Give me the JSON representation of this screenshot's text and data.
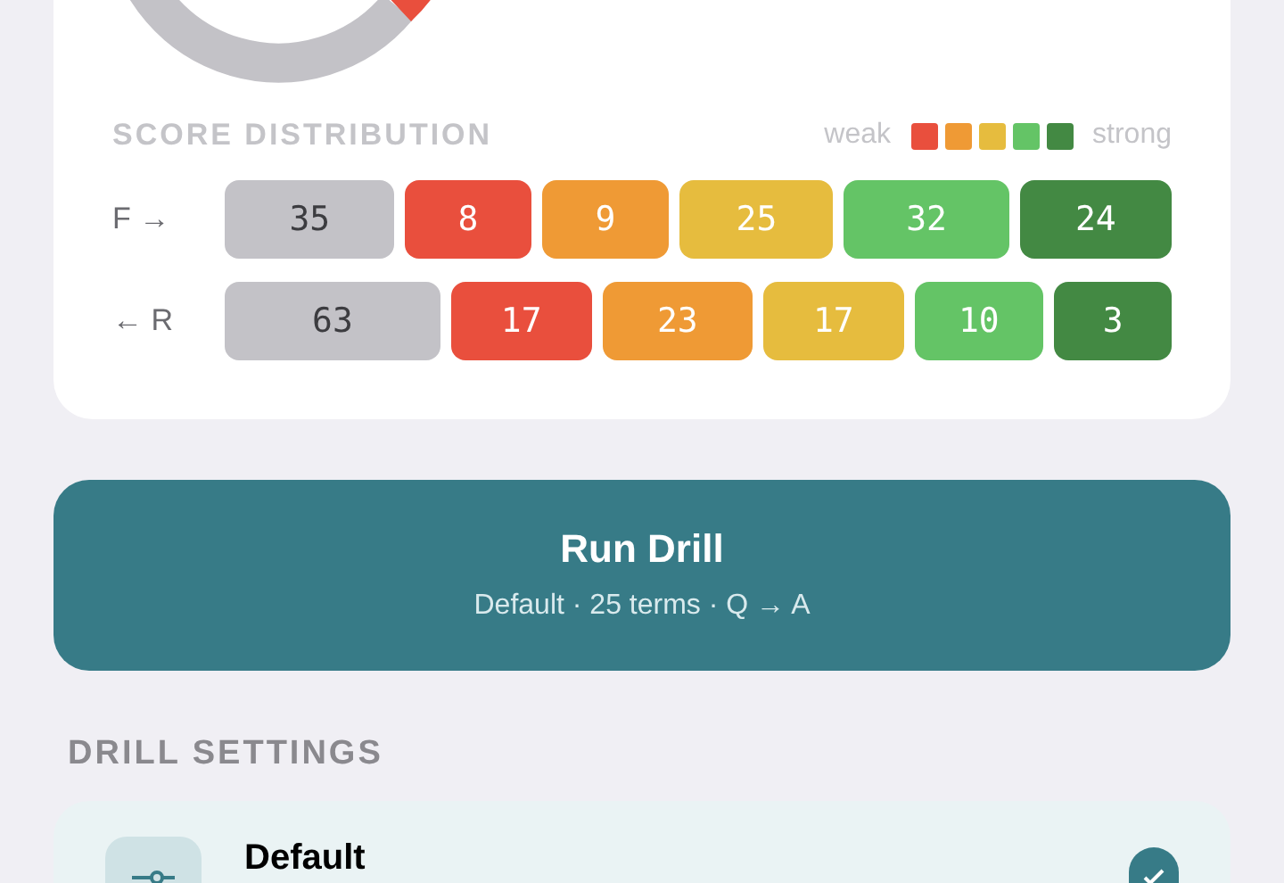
{
  "score_distribution": {
    "title": "SCORE DISTRIBUTION",
    "legend": {
      "weak_label": "weak",
      "strong_label": "strong",
      "swatches": [
        {
          "color": "#e94f3d"
        },
        {
          "color": "#ef9a35"
        },
        {
          "color": "#e6bc3e"
        },
        {
          "color": "#64c466"
        },
        {
          "color": "#438943"
        }
      ]
    },
    "rows": [
      {
        "label": "F →",
        "segments": [
          {
            "count": "35",
            "color": "#c3c2c7"
          },
          {
            "count": "8",
            "color": "#e94f3d"
          },
          {
            "count": "9",
            "color": "#ef9a35"
          },
          {
            "count": "25",
            "color": "#e6bc3e"
          },
          {
            "count": "32",
            "color": "#64c466"
          },
          {
            "count": "24",
            "color": "#438943"
          }
        ]
      },
      {
        "label": "← R",
        "segments": [
          {
            "count": "63",
            "color": "#c3c2c7"
          },
          {
            "count": "17",
            "color": "#e94f3d"
          },
          {
            "count": "23",
            "color": "#ef9a35"
          },
          {
            "count": "17",
            "color": "#e6bc3e"
          },
          {
            "count": "10",
            "color": "#64c466"
          },
          {
            "count": "3",
            "color": "#438943"
          }
        ]
      }
    ]
  },
  "run_button": {
    "title": "Run Drill",
    "subtitle": "Default · 25 terms · Q → A"
  },
  "drill_settings": {
    "title": "DRILL SETTINGS",
    "items": [
      {
        "name": "Default",
        "selected": true
      }
    ]
  }
}
